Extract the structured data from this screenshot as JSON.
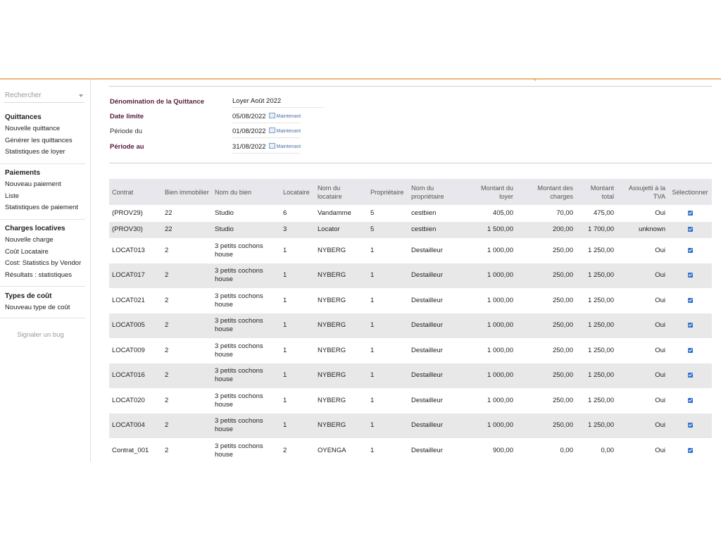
{
  "sidebar": {
    "search_placeholder": "Rechercher",
    "groups": [
      {
        "title": "Quittances",
        "items": [
          "Nouvelle quittance",
          "Générer les quittances",
          "Statistiques de loyer"
        ]
      },
      {
        "title": "Paiements",
        "items": [
          "Nouveau paiement",
          "Liste",
          "Statistiques de paiement"
        ]
      },
      {
        "title": "Charges locatives",
        "items": [
          "Nouvelle charge",
          "Coût Locataire",
          "Cost: Statistics by Vendor",
          "Résultats : statistiques"
        ]
      },
      {
        "title": "Types de coût",
        "items": [
          "Nouveau type de coût"
        ]
      }
    ],
    "bug_link": "Signaler un bug"
  },
  "form": {
    "denomination_label": "Dénomination de la Quittance",
    "denomination_value": "Loyer Août 2022",
    "date_limite_label": "Date limite",
    "date_limite_value": "05/08/2022",
    "periode_du_label": "Période du",
    "periode_du_value": "01/08/2022",
    "periode_au_label": "Période au",
    "periode_au_value": "31/08/2022",
    "now_label": "Maintenant"
  },
  "table": {
    "headers": [
      "Contrat",
      "Bien immobilier",
      "Nom du bien",
      "Locataire",
      "Nom du locataire",
      "Propriétaire",
      "Nom du propriétaire",
      "Montant du loyer",
      "Montant des charges",
      "Montant total",
      "Assujetti à la TVA",
      "Sélectionner"
    ],
    "rows": [
      {
        "contrat": "(PROV29)",
        "bien": "22",
        "nom_bien": "Studio",
        "locataire": "6",
        "nom_locataire": "Vandamme",
        "proprietaire": "5",
        "nom_proprietaire": "cestbien",
        "loyer": "405,00",
        "charges": "70,00",
        "total": "475,00",
        "tva": "Oui"
      },
      {
        "contrat": "(PROV30)",
        "bien": "22",
        "nom_bien": "Studio",
        "locataire": "3",
        "nom_locataire": "Locator",
        "proprietaire": "5",
        "nom_proprietaire": "cestbien",
        "loyer": "1 500,00",
        "charges": "200,00",
        "total": "1 700,00",
        "tva": "unknown"
      },
      {
        "contrat": "LOCAT013",
        "bien": "2",
        "nom_bien": "3 petits cochons house",
        "locataire": "1",
        "nom_locataire": "NYBERG",
        "proprietaire": "1",
        "nom_proprietaire": "Destailleur",
        "loyer": "1 000,00",
        "charges": "250,00",
        "total": "1 250,00",
        "tva": "Oui"
      },
      {
        "contrat": "LOCAT017",
        "bien": "2",
        "nom_bien": "3 petits cochons house",
        "locataire": "1",
        "nom_locataire": "NYBERG",
        "proprietaire": "1",
        "nom_proprietaire": "Destailleur",
        "loyer": "1 000,00",
        "charges": "250,00",
        "total": "1 250,00",
        "tva": "Oui"
      },
      {
        "contrat": "LOCAT021",
        "bien": "2",
        "nom_bien": "3 petits cochons house",
        "locataire": "1",
        "nom_locataire": "NYBERG",
        "proprietaire": "1",
        "nom_proprietaire": "Destailleur",
        "loyer": "1 000,00",
        "charges": "250,00",
        "total": "1 250,00",
        "tva": "Oui"
      },
      {
        "contrat": "LOCAT005",
        "bien": "2",
        "nom_bien": "3 petits cochons house",
        "locataire": "1",
        "nom_locataire": "NYBERG",
        "proprietaire": "1",
        "nom_proprietaire": "Destailleur",
        "loyer": "1 000,00",
        "charges": "250,00",
        "total": "1 250,00",
        "tva": "Oui"
      },
      {
        "contrat": "LOCAT009",
        "bien": "2",
        "nom_bien": "3 petits cochons house",
        "locataire": "1",
        "nom_locataire": "NYBERG",
        "proprietaire": "1",
        "nom_proprietaire": "Destailleur",
        "loyer": "1 000,00",
        "charges": "250,00",
        "total": "1 250,00",
        "tva": "Oui"
      },
      {
        "contrat": "LOCAT016",
        "bien": "2",
        "nom_bien": "3 petits cochons house",
        "locataire": "1",
        "nom_locataire": "NYBERG",
        "proprietaire": "1",
        "nom_proprietaire": "Destailleur",
        "loyer": "1 000,00",
        "charges": "250,00",
        "total": "1 250,00",
        "tva": "Oui"
      },
      {
        "contrat": "LOCAT020",
        "bien": "2",
        "nom_bien": "3 petits cochons house",
        "locataire": "1",
        "nom_locataire": "NYBERG",
        "proprietaire": "1",
        "nom_proprietaire": "Destailleur",
        "loyer": "1 000,00",
        "charges": "250,00",
        "total": "1 250,00",
        "tva": "Oui"
      },
      {
        "contrat": "LOCAT004",
        "bien": "2",
        "nom_bien": "3 petits cochons house",
        "locataire": "1",
        "nom_locataire": "NYBERG",
        "proprietaire": "1",
        "nom_proprietaire": "Destailleur",
        "loyer": "1 000,00",
        "charges": "250,00",
        "total": "1 250,00",
        "tva": "Oui"
      },
      {
        "contrat": "Contrat_001",
        "bien": "2",
        "nom_bien": "3 petits cochons house",
        "locataire": "2",
        "nom_locataire": "OYENGA",
        "proprietaire": "1",
        "nom_proprietaire": "Destailleur",
        "loyer": "900,00",
        "charges": "0,00",
        "total": "0,00",
        "tva": "Oui"
      }
    ]
  },
  "colors": {
    "accent_line": "#f2b47a",
    "required_label": "#5a1a3a",
    "checkbox": "#2f6fd0"
  }
}
